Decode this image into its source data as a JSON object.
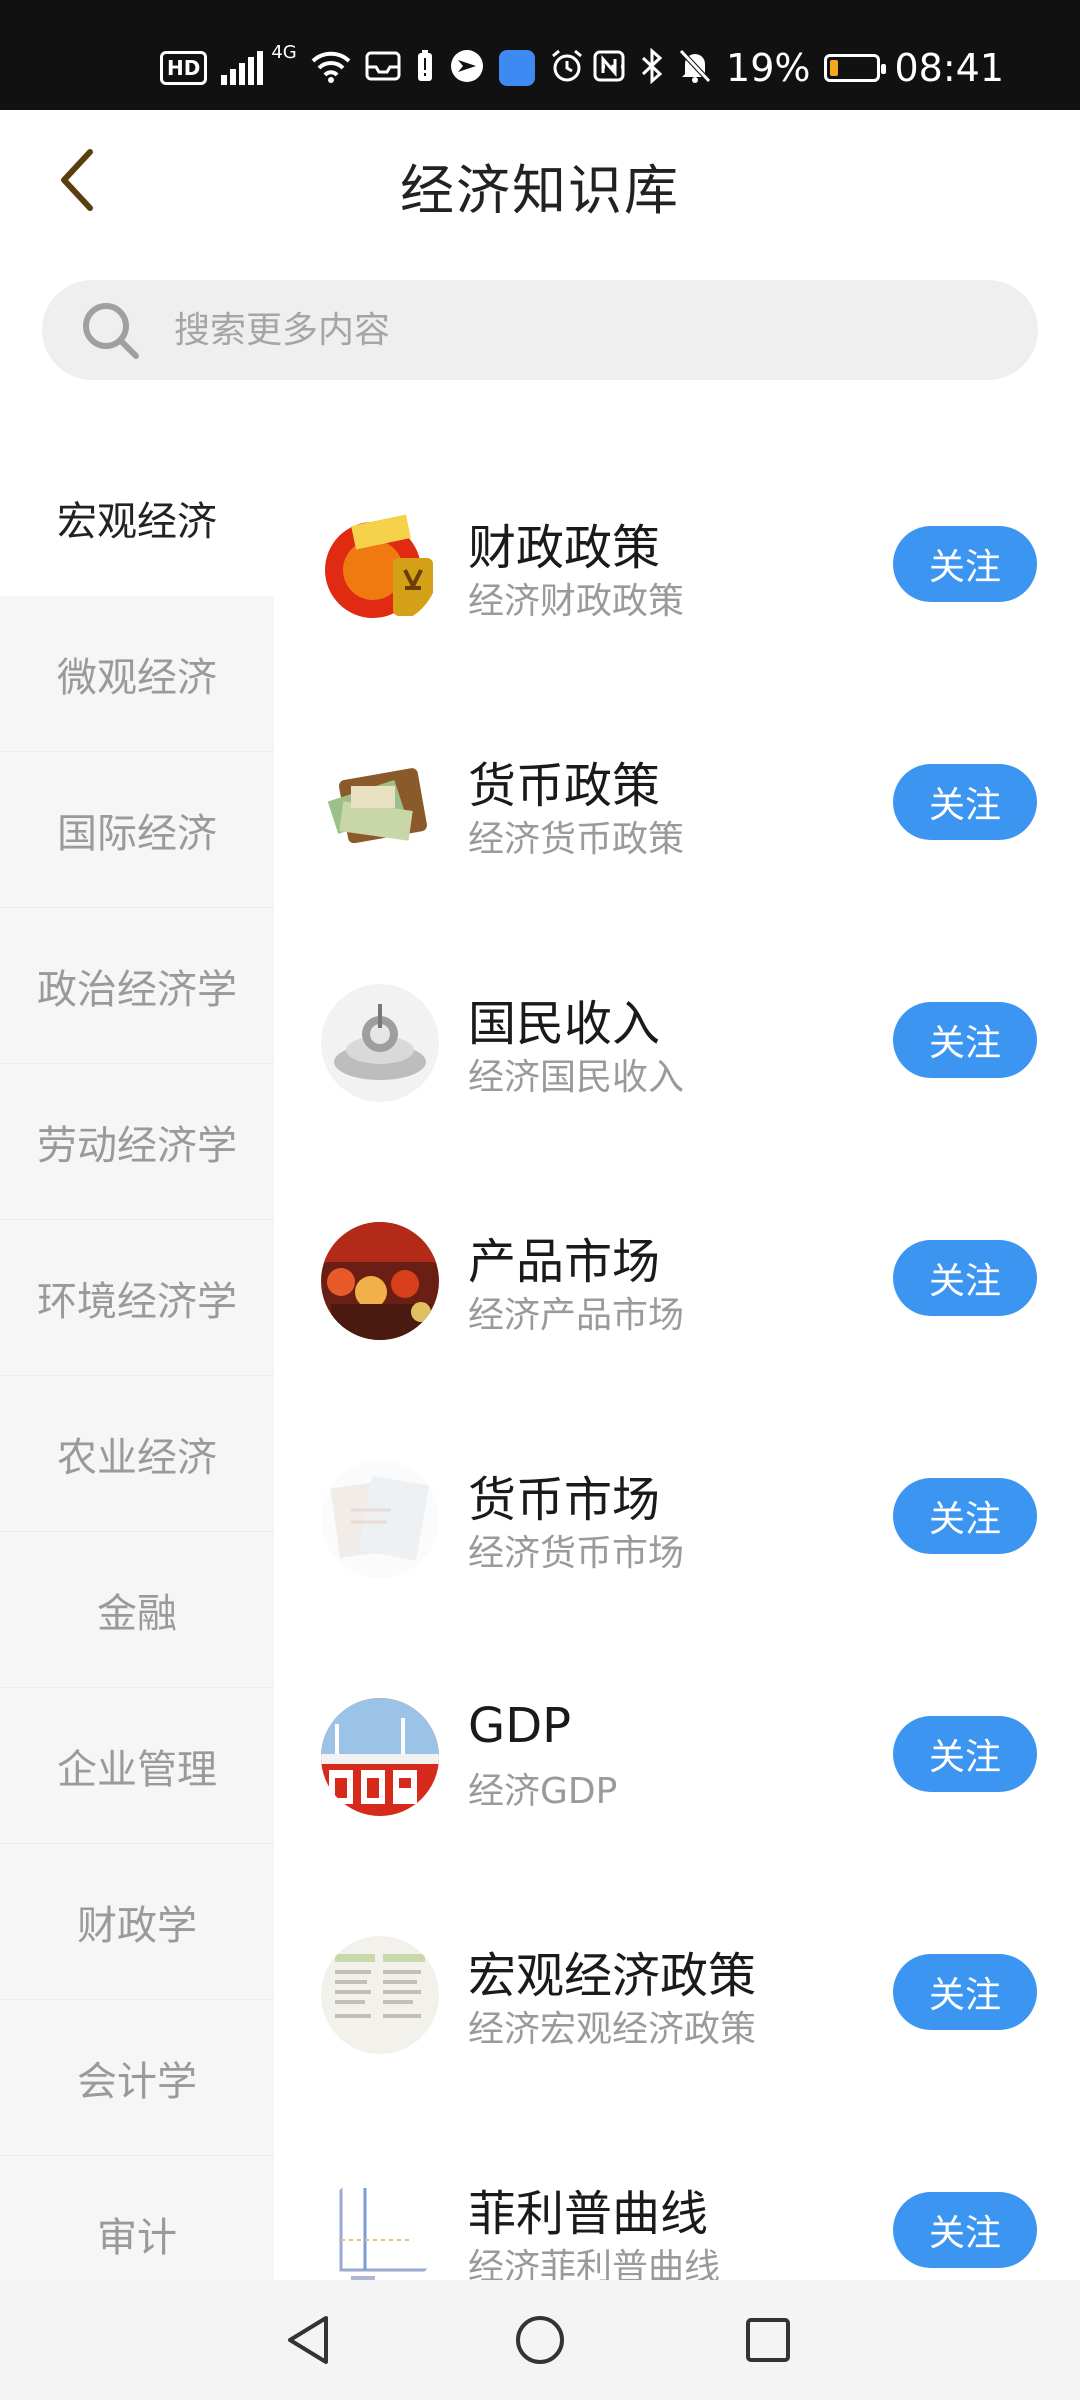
{
  "status_bar": {
    "hd": "HD",
    "network": "4G",
    "more": "···",
    "battery_percent": "19%",
    "battery_level": 0.19,
    "time": "08:41",
    "icons": [
      "hd-icon",
      "signal-icon",
      "wifi-icon",
      "inbox-icon",
      "battery-alert-icon",
      "app-icon",
      "app-blue-icon",
      "alarm-icon",
      "more-icon",
      "nfc-icon",
      "bluetooth-icon",
      "mute-icon",
      "battery-icon"
    ]
  },
  "header": {
    "title": "经济知识库",
    "back_icon": "chevron-left-icon"
  },
  "search": {
    "placeholder": "搜索更多内容",
    "icon": "search-icon"
  },
  "sidebar": {
    "items": [
      {
        "label": "宏观经济",
        "active": true
      },
      {
        "label": "微观经济",
        "active": false
      },
      {
        "label": "国际经济",
        "active": false
      },
      {
        "label": "政治经济学",
        "active": false
      },
      {
        "label": "劳动经济学",
        "active": false
      },
      {
        "label": "环境经济学",
        "active": false
      },
      {
        "label": "农业经济",
        "active": false
      },
      {
        "label": "金融",
        "active": false
      },
      {
        "label": "企业管理",
        "active": false
      },
      {
        "label": "财政学",
        "active": false
      },
      {
        "label": "会计学",
        "active": false
      },
      {
        "label": "审计",
        "active": false
      }
    ]
  },
  "list": {
    "follow_label": "关注",
    "items": [
      {
        "title": "财政政策",
        "subtitle": "经济财政政策"
      },
      {
        "title": "货币政策",
        "subtitle": "经济货币政策"
      },
      {
        "title": "国民收入",
        "subtitle": "经济国民收入"
      },
      {
        "title": "产品市场",
        "subtitle": "经济产品市场"
      },
      {
        "title": "货币市场",
        "subtitle": "经济货币市场"
      },
      {
        "title": "GDP",
        "subtitle": "经济GDP"
      },
      {
        "title": "宏观经济政策",
        "subtitle": "经济宏观经济政策"
      },
      {
        "title": "菲利普曲线",
        "subtitle": "经济菲利普曲线"
      }
    ]
  },
  "nav_bar": {
    "icons": [
      "back-triangle-icon",
      "home-circle-icon",
      "recents-square-icon"
    ]
  },
  "colors": {
    "accent": "#3d95f2",
    "status_bar": "#111111",
    "sidebar_bg": "#f6f6f6",
    "search_bg": "#efefef"
  }
}
